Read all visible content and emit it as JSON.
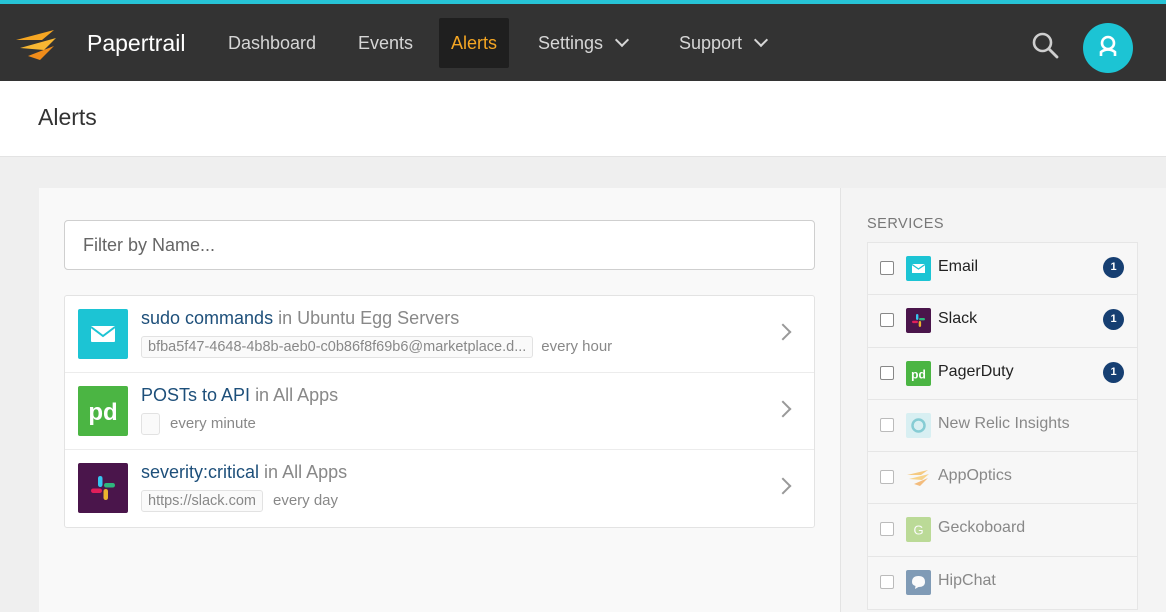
{
  "brand": {
    "name": "Papertrail"
  },
  "nav": {
    "items": [
      {
        "label": "Dashboard"
      },
      {
        "label": "Events"
      },
      {
        "label": "Alerts"
      },
      {
        "label": "Settings"
      },
      {
        "label": "Support"
      }
    ],
    "active": "Alerts"
  },
  "page": {
    "title": "Alerts"
  },
  "filter": {
    "placeholder": "Filter by Name..."
  },
  "alerts": [
    {
      "name": "sudo commands",
      "in_text": "in Ubuntu Egg Servers",
      "destination": "bfba5f47-4648-4b8b-aeb0-c0b86f8f69b6@marketplace.d...",
      "frequency": "every hour",
      "icon": "email-icon"
    },
    {
      "name": "POSTs to API",
      "in_text": "in All Apps",
      "destination": "",
      "frequency": "every minute",
      "icon": "pagerduty-icon"
    },
    {
      "name": "severity:critical",
      "in_text": "in All Apps",
      "destination": "https://slack.com",
      "frequency": "every day",
      "icon": "slack-icon"
    }
  ],
  "services": {
    "heading": "SERVICES",
    "items": [
      {
        "label": "Email",
        "count": "1",
        "icon": "email-icon"
      },
      {
        "label": "Slack",
        "count": "1",
        "icon": "slack-icon"
      },
      {
        "label": "PagerDuty",
        "count": "1",
        "icon": "pagerduty-icon"
      },
      {
        "label": "New Relic Insights",
        "icon": "new-relic-icon"
      },
      {
        "label": "AppOptics",
        "icon": "appoptics-icon"
      },
      {
        "label": "Geckoboard",
        "icon": "geckoboard-icon"
      },
      {
        "label": "HipChat",
        "icon": "hipchat-icon"
      }
    ]
  },
  "colors": {
    "accent_bar": "#27c4d6",
    "nav_active": "#f5a623",
    "email": "#1cc4d4",
    "pagerduty": "#4bb543",
    "slack": "#4a154b",
    "badge": "#163f72"
  }
}
